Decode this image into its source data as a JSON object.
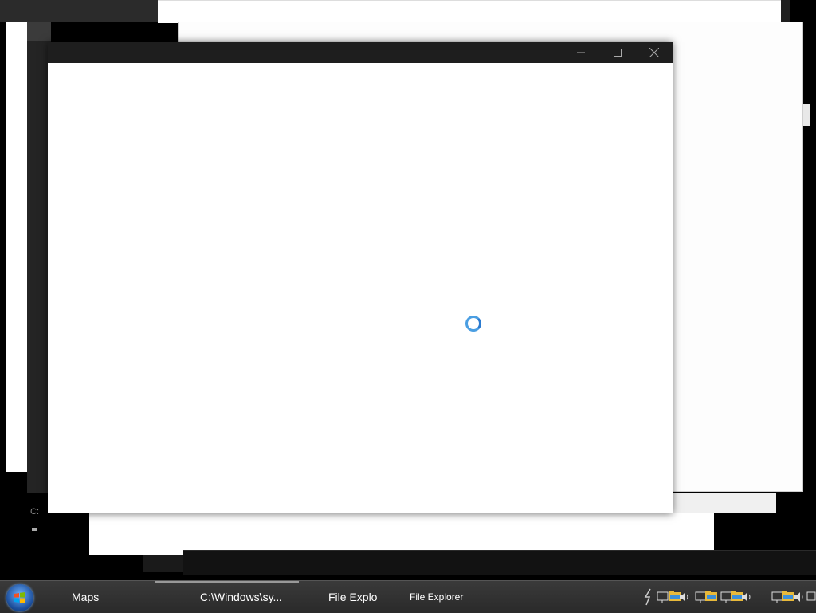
{
  "main_window": {
    "state": "loading",
    "accent_color": "#4a9ee2"
  },
  "taskbar": {
    "items": [
      {
        "label": "Maps"
      },
      {
        "label": "C:\\Windows\\sy..."
      },
      {
        "label": "File Explo"
      },
      {
        "label": "File Explorer"
      }
    ]
  },
  "tray_icons": [
    "network-icon",
    "folder-icon",
    "volume-icon",
    "monitor-icon"
  ],
  "background": {
    "cmd_prompt_text": "C:"
  }
}
